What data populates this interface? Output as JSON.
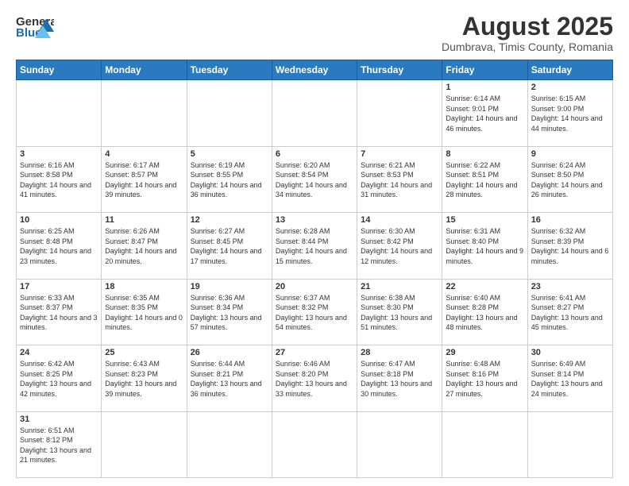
{
  "header": {
    "logo_general": "General",
    "logo_blue": "Blue",
    "month_title": "August 2025",
    "location": "Dumbrava, Timis County, Romania"
  },
  "days_of_week": [
    "Sunday",
    "Monday",
    "Tuesday",
    "Wednesday",
    "Thursday",
    "Friday",
    "Saturday"
  ],
  "weeks": [
    [
      {
        "day": "",
        "info": ""
      },
      {
        "day": "",
        "info": ""
      },
      {
        "day": "",
        "info": ""
      },
      {
        "day": "",
        "info": ""
      },
      {
        "day": "",
        "info": ""
      },
      {
        "day": "1",
        "info": "Sunrise: 6:14 AM\nSunset: 9:01 PM\nDaylight: 14 hours and 46 minutes."
      },
      {
        "day": "2",
        "info": "Sunrise: 6:15 AM\nSunset: 9:00 PM\nDaylight: 14 hours and 44 minutes."
      }
    ],
    [
      {
        "day": "3",
        "info": "Sunrise: 6:16 AM\nSunset: 8:58 PM\nDaylight: 14 hours and 41 minutes."
      },
      {
        "day": "4",
        "info": "Sunrise: 6:17 AM\nSunset: 8:57 PM\nDaylight: 14 hours and 39 minutes."
      },
      {
        "day": "5",
        "info": "Sunrise: 6:19 AM\nSunset: 8:55 PM\nDaylight: 14 hours and 36 minutes."
      },
      {
        "day": "6",
        "info": "Sunrise: 6:20 AM\nSunset: 8:54 PM\nDaylight: 14 hours and 34 minutes."
      },
      {
        "day": "7",
        "info": "Sunrise: 6:21 AM\nSunset: 8:53 PM\nDaylight: 14 hours and 31 minutes."
      },
      {
        "day": "8",
        "info": "Sunrise: 6:22 AM\nSunset: 8:51 PM\nDaylight: 14 hours and 28 minutes."
      },
      {
        "day": "9",
        "info": "Sunrise: 6:24 AM\nSunset: 8:50 PM\nDaylight: 14 hours and 26 minutes."
      }
    ],
    [
      {
        "day": "10",
        "info": "Sunrise: 6:25 AM\nSunset: 8:48 PM\nDaylight: 14 hours and 23 minutes."
      },
      {
        "day": "11",
        "info": "Sunrise: 6:26 AM\nSunset: 8:47 PM\nDaylight: 14 hours and 20 minutes."
      },
      {
        "day": "12",
        "info": "Sunrise: 6:27 AM\nSunset: 8:45 PM\nDaylight: 14 hours and 17 minutes."
      },
      {
        "day": "13",
        "info": "Sunrise: 6:28 AM\nSunset: 8:44 PM\nDaylight: 14 hours and 15 minutes."
      },
      {
        "day": "14",
        "info": "Sunrise: 6:30 AM\nSunset: 8:42 PM\nDaylight: 14 hours and 12 minutes."
      },
      {
        "day": "15",
        "info": "Sunrise: 6:31 AM\nSunset: 8:40 PM\nDaylight: 14 hours and 9 minutes."
      },
      {
        "day": "16",
        "info": "Sunrise: 6:32 AM\nSunset: 8:39 PM\nDaylight: 14 hours and 6 minutes."
      }
    ],
    [
      {
        "day": "17",
        "info": "Sunrise: 6:33 AM\nSunset: 8:37 PM\nDaylight: 14 hours and 3 minutes."
      },
      {
        "day": "18",
        "info": "Sunrise: 6:35 AM\nSunset: 8:35 PM\nDaylight: 14 hours and 0 minutes."
      },
      {
        "day": "19",
        "info": "Sunrise: 6:36 AM\nSunset: 8:34 PM\nDaylight: 13 hours and 57 minutes."
      },
      {
        "day": "20",
        "info": "Sunrise: 6:37 AM\nSunset: 8:32 PM\nDaylight: 13 hours and 54 minutes."
      },
      {
        "day": "21",
        "info": "Sunrise: 6:38 AM\nSunset: 8:30 PM\nDaylight: 13 hours and 51 minutes."
      },
      {
        "day": "22",
        "info": "Sunrise: 6:40 AM\nSunset: 8:28 PM\nDaylight: 13 hours and 48 minutes."
      },
      {
        "day": "23",
        "info": "Sunrise: 6:41 AM\nSunset: 8:27 PM\nDaylight: 13 hours and 45 minutes."
      }
    ],
    [
      {
        "day": "24",
        "info": "Sunrise: 6:42 AM\nSunset: 8:25 PM\nDaylight: 13 hours and 42 minutes."
      },
      {
        "day": "25",
        "info": "Sunrise: 6:43 AM\nSunset: 8:23 PM\nDaylight: 13 hours and 39 minutes."
      },
      {
        "day": "26",
        "info": "Sunrise: 6:44 AM\nSunset: 8:21 PM\nDaylight: 13 hours and 36 minutes."
      },
      {
        "day": "27",
        "info": "Sunrise: 6:46 AM\nSunset: 8:20 PM\nDaylight: 13 hours and 33 minutes."
      },
      {
        "day": "28",
        "info": "Sunrise: 6:47 AM\nSunset: 8:18 PM\nDaylight: 13 hours and 30 minutes."
      },
      {
        "day": "29",
        "info": "Sunrise: 6:48 AM\nSunset: 8:16 PM\nDaylight: 13 hours and 27 minutes."
      },
      {
        "day": "30",
        "info": "Sunrise: 6:49 AM\nSunset: 8:14 PM\nDaylight: 13 hours and 24 minutes."
      }
    ],
    [
      {
        "day": "31",
        "info": "Sunrise: 6:51 AM\nSunset: 8:12 PM\nDaylight: 13 hours and 21 minutes."
      },
      {
        "day": "",
        "info": ""
      },
      {
        "day": "",
        "info": ""
      },
      {
        "day": "",
        "info": ""
      },
      {
        "day": "",
        "info": ""
      },
      {
        "day": "",
        "info": ""
      },
      {
        "day": "",
        "info": ""
      }
    ]
  ]
}
